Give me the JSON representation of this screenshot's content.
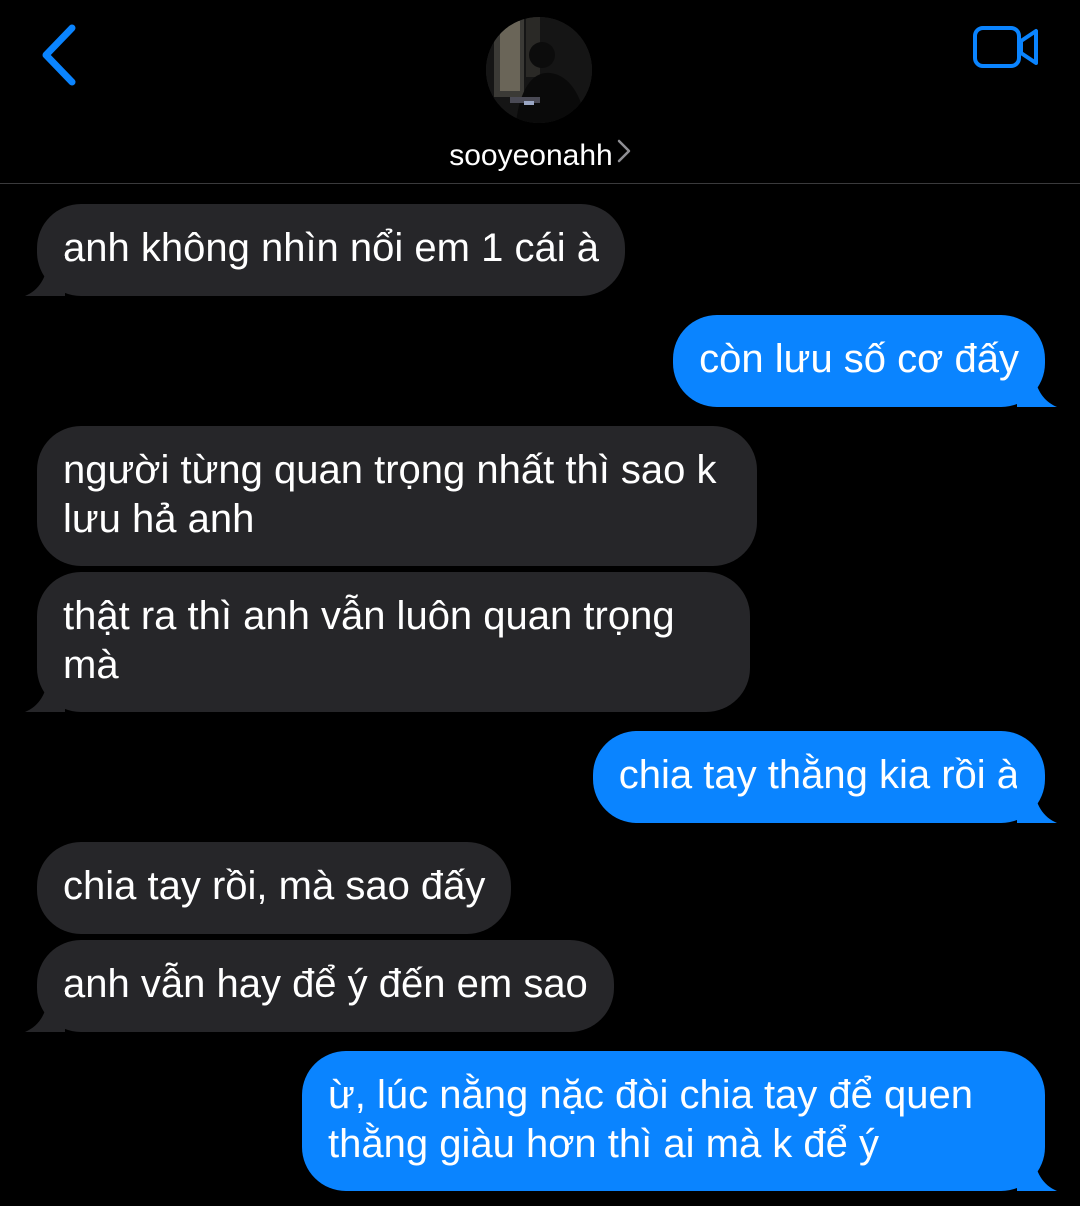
{
  "header": {
    "contact_name": "sooyeonahh",
    "back_icon": "chevron-left-icon",
    "video_icon": "video-camera-icon",
    "accent_color": "#0a84ff"
  },
  "messages": [
    {
      "direction": "incoming",
      "text": "anh không nhìn nổi em 1 cái à"
    },
    {
      "direction": "outgoing",
      "text": "còn lưu số cơ đấy"
    },
    {
      "direction": "incoming",
      "text": "người từng quan trọng nhất thì sao k lưu hả anh"
    },
    {
      "direction": "incoming",
      "text": "thật ra thì anh vẫn luôn quan trọng mà"
    },
    {
      "direction": "outgoing",
      "text": "chia tay thằng kia rồi à"
    },
    {
      "direction": "incoming",
      "text": "chia tay rồi, mà sao đấy"
    },
    {
      "direction": "incoming",
      "text": "anh vẫn hay để ý đến em sao"
    },
    {
      "direction": "outgoing",
      "text": "ừ, lúc nằng nặc đòi chia tay để quen thằng giàu hơn thì ai mà k để ý"
    }
  ]
}
